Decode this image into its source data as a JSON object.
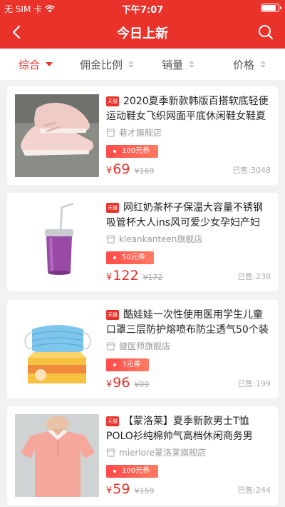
{
  "status_bar": {
    "carrier": "无 SIM 卡",
    "time": "下午7:07",
    "battery_level": 0.9
  },
  "nav": {
    "title": "今日上新",
    "back_icon": "chevron-left-icon",
    "search_icon": "search-icon"
  },
  "sort_tabs": [
    {
      "label": "综合",
      "active": true
    },
    {
      "label": "佣金比例",
      "active": false
    },
    {
      "label": "销量",
      "active": false
    },
    {
      "label": "价格",
      "active": false
    }
  ],
  "colors": {
    "brand": "#e8322a",
    "price": "#e8322a",
    "muted": "#999999"
  },
  "products": [
    {
      "badge": "天猫",
      "title": "2020夏季新款韩版百搭软底轻便运动鞋女飞织网面平底休闲鞋女鞋夏",
      "shop": "巷才旗舰店",
      "coupon": "100元券",
      "price_symbol": "¥",
      "price": "69",
      "original_price": "¥169",
      "sold": "已售:3048",
      "image": "sneaker-image"
    },
    {
      "badge": "天猫",
      "title": "网红奶茶杯子保温大容量不锈钢吸管杯大人ins风可爱少女孕妇产妇",
      "shop": "kleankanteen旗舰店",
      "coupon": "50元券",
      "price_symbol": "¥",
      "price": "122",
      "original_price": "¥172",
      "sold": "已售:238",
      "image": "tumbler-image"
    },
    {
      "badge": "天猫",
      "title": "酷娃娃一次性使用医用学生儿童口罩三层防护熔喷布防尘透气50个装",
      "shop": "健医师旗舰店",
      "coupon": "3元券",
      "price_symbol": "¥",
      "price": "96",
      "original_price": "¥99",
      "sold": "已售:199",
      "image": "mask-image"
    },
    {
      "badge": "天猫",
      "title": "【蒙洛莱】夏季新款男士T恤POLO衫纯棉帅气高档休闲商务男上...",
      "shop": "mierlore蒙洛莱旗舰店",
      "coupon": "100元券",
      "price_symbol": "¥",
      "price": "59",
      "original_price": "¥159",
      "sold": "已售:244",
      "image": "polo-shirt-image"
    }
  ]
}
